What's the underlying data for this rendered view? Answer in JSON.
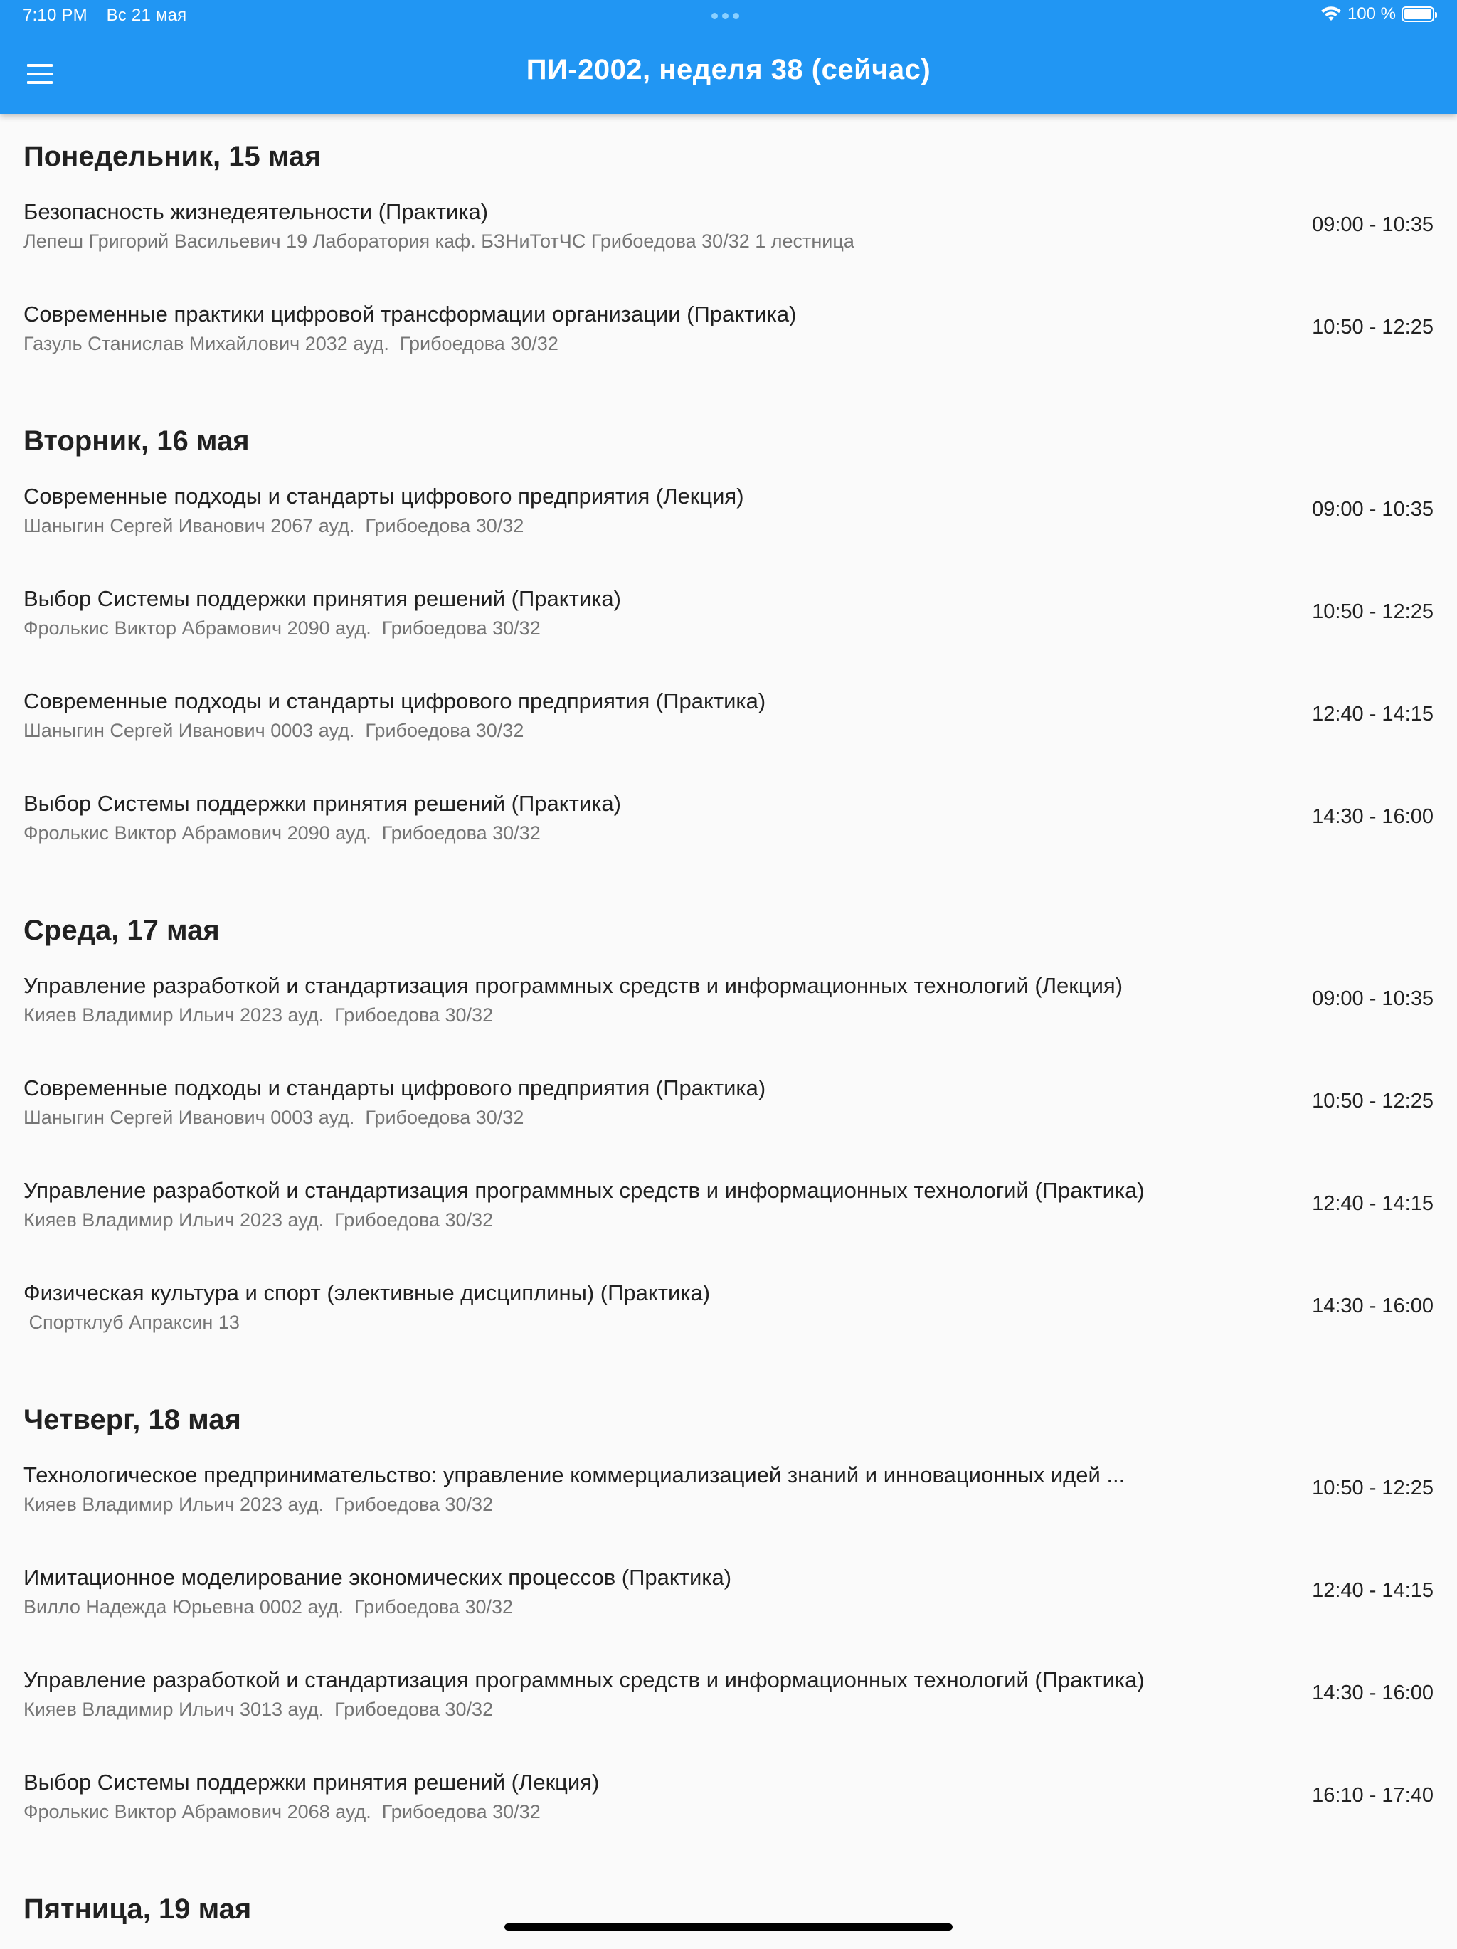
{
  "status_bar": {
    "time": "7:10 PM",
    "date": "Вс 21 мая",
    "battery": "100 %",
    "battery_level": 1.0
  },
  "app_bar": {
    "title": "ПИ-2002, неделя 38 (сейчас)",
    "menu_icon": "hamburger-menu-icon"
  },
  "days": [
    {
      "header": "Понедельник, 15 мая",
      "lessons": [
        {
          "title": "Безопасность жизнедеятельности (Практика)",
          "details": "Лепеш Григорий Васильевич 19 Лаборатория каф. БЗНиТотЧС Грибоедова 30/32 1 лестница",
          "time": "09:00 - 10:35"
        },
        {
          "title": "Современные практики цифровой трансформации организации (Практика)",
          "details": "Газуль Станислав Михайлович 2032 ауд.  Грибоедова 30/32",
          "time": "10:50 - 12:25"
        }
      ]
    },
    {
      "header": "Вторник, 16 мая",
      "lessons": [
        {
          "title": "Современные подходы и стандарты цифрового предприятия (Лекция)",
          "details": "Шаныгин Сергей Иванович 2067 ауд.  Грибоедова 30/32",
          "time": "09:00 - 10:35"
        },
        {
          "title": "Выбор Системы поддержки принятия решений (Практика)",
          "details": "Фролькис Виктор Абрамович 2090 ауд.  Грибоедова 30/32",
          "time": "10:50 - 12:25"
        },
        {
          "title": "Современные подходы и стандарты цифрового предприятия (Практика)",
          "details": "Шаныгин Сергей Иванович 0003 ауд.  Грибоедова 30/32",
          "time": "12:40 - 14:15"
        },
        {
          "title": "Выбор Системы поддержки принятия решений (Практика)",
          "details": "Фролькис Виктор Абрамович 2090 ауд.  Грибоедова 30/32",
          "time": "14:30 - 16:00"
        }
      ]
    },
    {
      "header": "Среда, 17 мая",
      "lessons": [
        {
          "title": "Управление разработкой и стандартизация программных средств и информационных технологий (Лекция)",
          "details": "Кияев Владимир Ильич 2023 ауд.  Грибоедова 30/32",
          "time": "09:00 - 10:35"
        },
        {
          "title": "Современные подходы и стандарты цифрового предприятия (Практика)",
          "details": "Шаныгин Сергей Иванович 0003 ауд.  Грибоедова 30/32",
          "time": "10:50 - 12:25"
        },
        {
          "title": "Управление разработкой и стандартизация программных средств и информационных технологий (Практика)",
          "details": "Кияев Владимир Ильич 2023 ауд.  Грибоедова 30/32",
          "time": "12:40 - 14:15"
        },
        {
          "title": "Физическая культура и спорт (элективные дисциплины) (Практика)",
          "details": " Спортклуб Апраксин 13",
          "time": "14:30 - 16:00"
        }
      ]
    },
    {
      "header": "Четверг, 18 мая",
      "lessons": [
        {
          "title": "Технологическое предпринимательство: управление коммерциализацией знаний и инновационных идей ...",
          "details": "Кияев Владимир Ильич 2023 ауд.  Грибоедова 30/32",
          "time": "10:50 - 12:25"
        },
        {
          "title": "Имитационное моделирование экономических процессов (Практика)",
          "details": "Вилло Надежда Юрьевна 0002 ауд.  Грибоедова 30/32",
          "time": "12:40 - 14:15"
        },
        {
          "title": "Управление разработкой и стандартизация программных средств и информационных технологий (Практика)",
          "details": "Кияев Владимир Ильич 3013 ауд.  Грибоедова 30/32",
          "time": "14:30 - 16:00"
        },
        {
          "title": "Выбор Системы поддержки принятия решений (Лекция)",
          "details": "Фролькис Виктор Абрамович 2068 ауд.  Грибоедова 30/32",
          "time": "16:10 - 17:40"
        }
      ]
    },
    {
      "header": "Пятница, 19 мая",
      "lessons": []
    }
  ]
}
